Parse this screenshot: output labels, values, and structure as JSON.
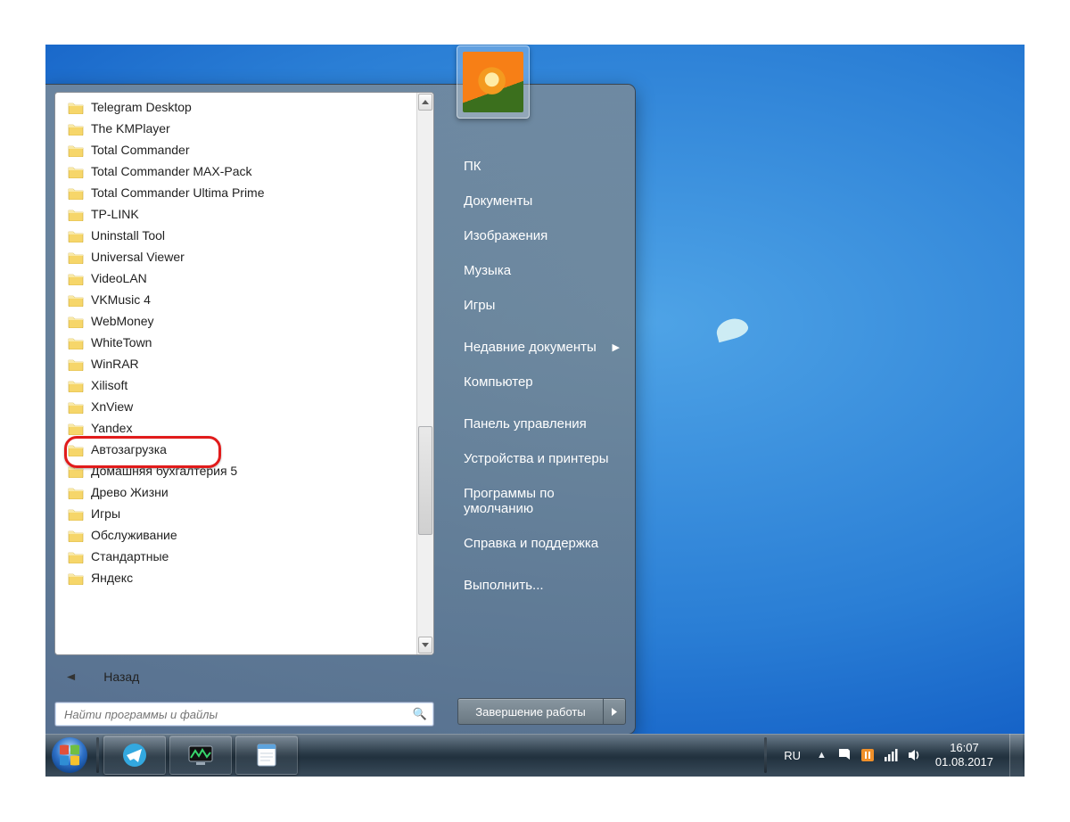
{
  "start_menu": {
    "programs": [
      "Telegram Desktop",
      "The KMPlayer",
      "Total Commander",
      "Total Commander MAX-Pack",
      "Total Commander Ultima Prime",
      "TP-LINK",
      "Uninstall Tool",
      "Universal Viewer",
      "VideoLAN",
      "VKMusic 4",
      "WebMoney",
      "WhiteTown",
      "WinRAR",
      "Xilisoft",
      "XnView",
      "Yandex",
      "Автозагрузка",
      "Домашняя бухгалтерия 5",
      "Древо Жизни",
      "Игры",
      "Обслуживание",
      "Стандартные",
      "Яндекс"
    ],
    "highlight_index": 16,
    "back_label": "Назад",
    "search_placeholder": "Найти программы и файлы",
    "right_links": [
      {
        "label": "ПК"
      },
      {
        "label": "Документы"
      },
      {
        "label": "Изображения"
      },
      {
        "label": "Музыка"
      },
      {
        "label": "Игры"
      },
      {
        "label": "Недавние документы",
        "arrow": true
      },
      {
        "label": "Компьютер"
      },
      {
        "label": "Панель управления"
      },
      {
        "label": "Устройства и принтеры"
      },
      {
        "label": "Программы по умолчанию"
      },
      {
        "label": "Справка и поддержка"
      },
      {
        "label": "Выполнить..."
      }
    ],
    "gap_after": [
      4,
      6,
      10
    ],
    "shutdown_label": "Завершение работы"
  },
  "taskbar": {
    "lang": "RU",
    "clock_time": "16:07",
    "clock_date": "01.08.2017"
  }
}
